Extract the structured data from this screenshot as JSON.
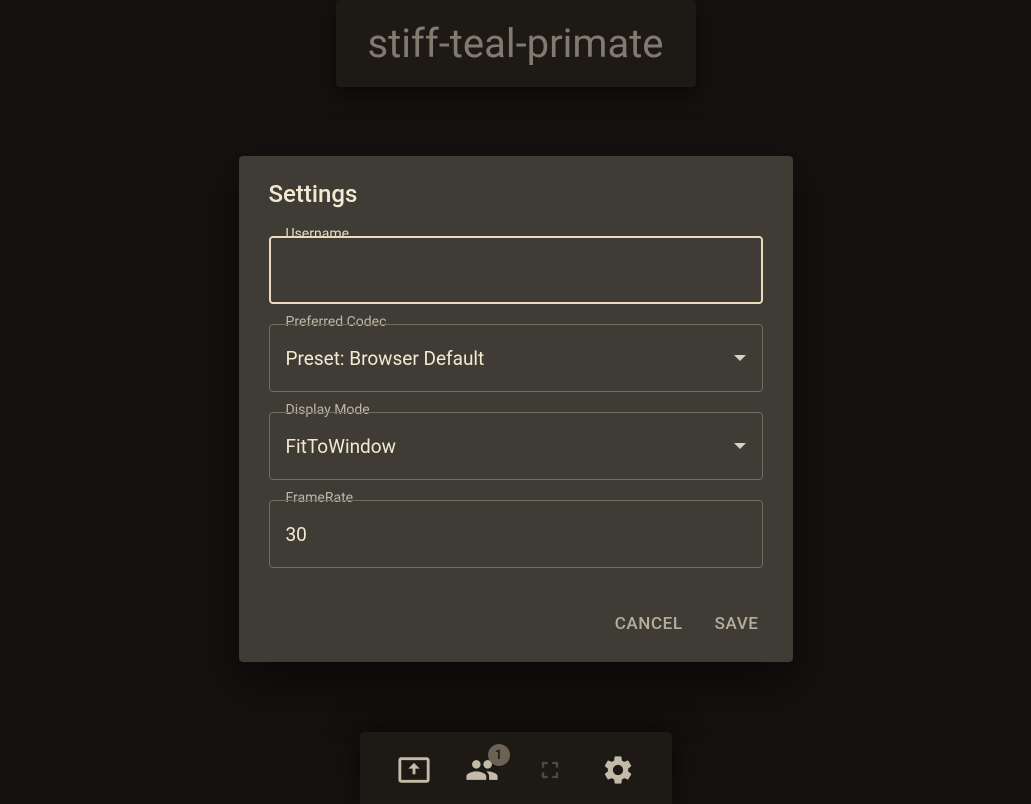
{
  "session_name": "stiff-teal-primate",
  "dialog": {
    "title": "Settings",
    "username": {
      "label": "Username",
      "value": ""
    },
    "codec": {
      "label": "Preferred Codec",
      "value": "Preset: Browser Default"
    },
    "display_mode": {
      "label": "Display Mode",
      "value": "FitToWindow"
    },
    "framerate": {
      "label": "FrameRate",
      "value": "30"
    },
    "cancel_label": "CANCEL",
    "save_label": "SAVE"
  },
  "toolbar": {
    "participants_badge": "1"
  }
}
